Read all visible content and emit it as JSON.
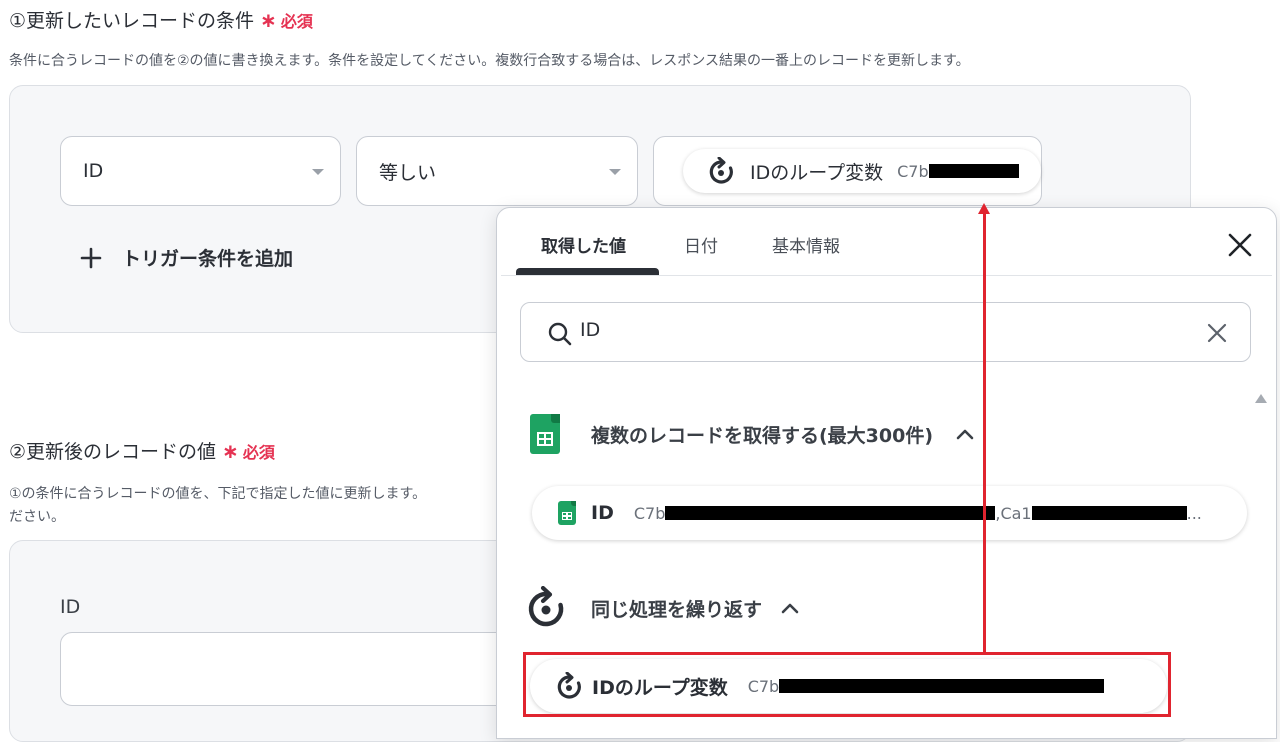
{
  "section1": {
    "title": "①更新したいレコードの条件",
    "required": "必須",
    "description": "条件に合うレコードの値を②の値に書き換えます。条件を設定してください。複数行合致する場合は、レスポンス結果の一番上のレコードを更新します。",
    "field_select": "ID",
    "operator_select": "等しい",
    "value_chip": {
      "label": "IDのループ変数",
      "value_prefix": "C7b"
    },
    "add_condition": "トリガー条件を追加"
  },
  "section2": {
    "title": "②更新後のレコードの値",
    "required": "必須",
    "description_line1": "①の条件に合うレコードの値を、下記で指定した値に更新します。",
    "description_line2": "ださい。",
    "id_label": "ID"
  },
  "popup": {
    "tabs": [
      "取得した値",
      "日付",
      "基本情報"
    ],
    "active_tab": "取得した値",
    "search": {
      "value": "ID",
      "placeholder": ""
    },
    "group1": {
      "title": "複数のレコードを取得する(最大300件)",
      "item": {
        "name": "ID",
        "value_prefix": "C7b",
        "value_mid": ",Ca1",
        "ellipsis": "..."
      }
    },
    "group2": {
      "title": "同じ処理を繰り返す",
      "item": {
        "name": "IDのループ変数",
        "value_prefix": "C7b"
      }
    }
  },
  "colors": {
    "required_red": "#e53252",
    "highlight_red": "#e0242f",
    "sheet_green": "#1ea362",
    "tab_underline": "#2b2f36"
  },
  "icons": [
    "caret-down-icon",
    "plus-icon",
    "loop-icon",
    "close-icon",
    "search-icon",
    "clear-icon",
    "sheets-icon",
    "chevron-up-icon",
    "scroll-up-arrow-icon"
  ]
}
